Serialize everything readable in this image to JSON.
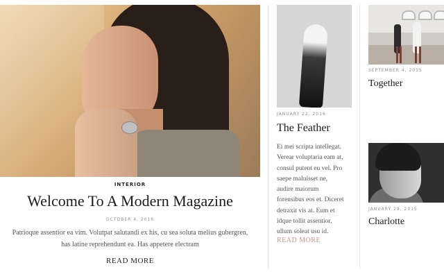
{
  "feature": {
    "category": "INTERIOR",
    "title": "Welcome To A Modern Magazine",
    "date": "OCTOBER 4, 2016",
    "excerpt_line1": "Patrioque assentior ea vim. Volutpat salutandi ex his, cu sea soluta melius gubergren,",
    "excerpt_line2": "has latine reprehendunt ea. Has appetere electram",
    "read_more": "READ MORE"
  },
  "middle_post": {
    "date": "JANUARY 22, 2016",
    "title": "The Feather",
    "excerpt_lines": [
      "Ei mei scripta intellegat.",
      "Verear voluptaria eam at,",
      "consul putent eu vel. Pro",
      "saepe maluisset ne,",
      "audire maiorum",
      "forensibus eos et. Diceret",
      "detraxit vis at. Eum et",
      "idque tollit assentior,",
      "ullum soleat usu id."
    ],
    "read_more": "READ MORE",
    "accent_color": "#c9938a"
  },
  "right_posts": [
    {
      "date": "SEPTEMBER 4, 2015",
      "title": "Together"
    },
    {
      "date": "JANUARY 29, 2015",
      "title": "Charlotte"
    }
  ]
}
